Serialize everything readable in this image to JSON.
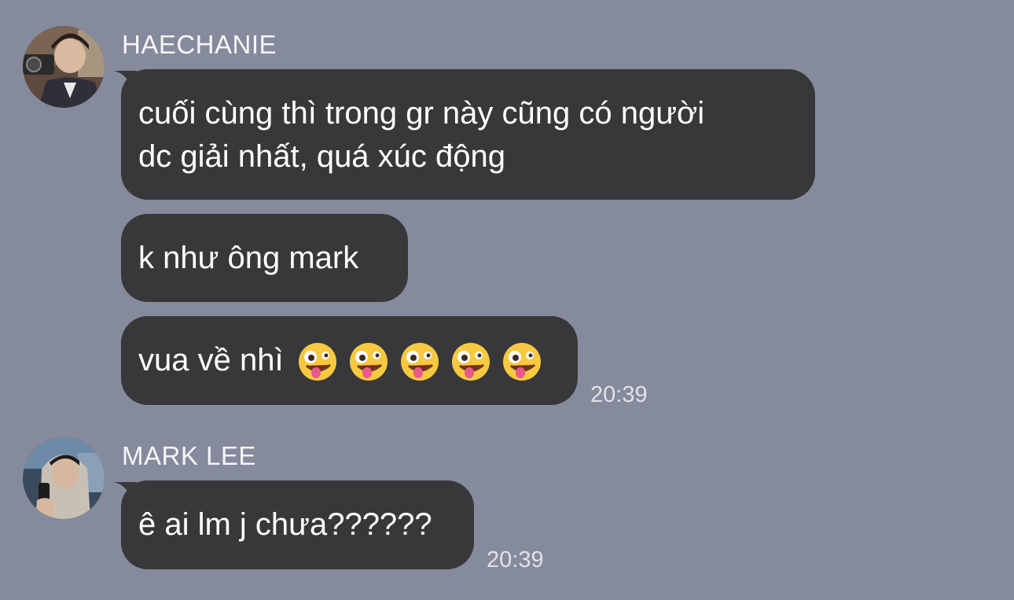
{
  "chat": {
    "groups": [
      {
        "sender": "HAECHANIE",
        "messages": [
          {
            "lines": [
              "cuối cùng thì trong gr này cũng có người",
              "dc giải nhất, quá xúc động"
            ]
          },
          {
            "lines": [
              "k như ông mark"
            ]
          },
          {
            "text": "vua về nhì",
            "emoji": [
              "zany-face-emoji",
              "zany-face-emoji",
              "zany-face-emoji",
              "zany-face-emoji",
              "zany-face-emoji"
            ],
            "time": "20:39"
          }
        ]
      },
      {
        "sender": "MARK LEE",
        "messages": [
          {
            "lines": [
              "ê ai lm j chưa??????"
            ],
            "time": "20:39"
          }
        ]
      }
    ]
  },
  "colors": {
    "background": "#858b9c",
    "bubble": "#38383a",
    "text": "#ffffff"
  }
}
